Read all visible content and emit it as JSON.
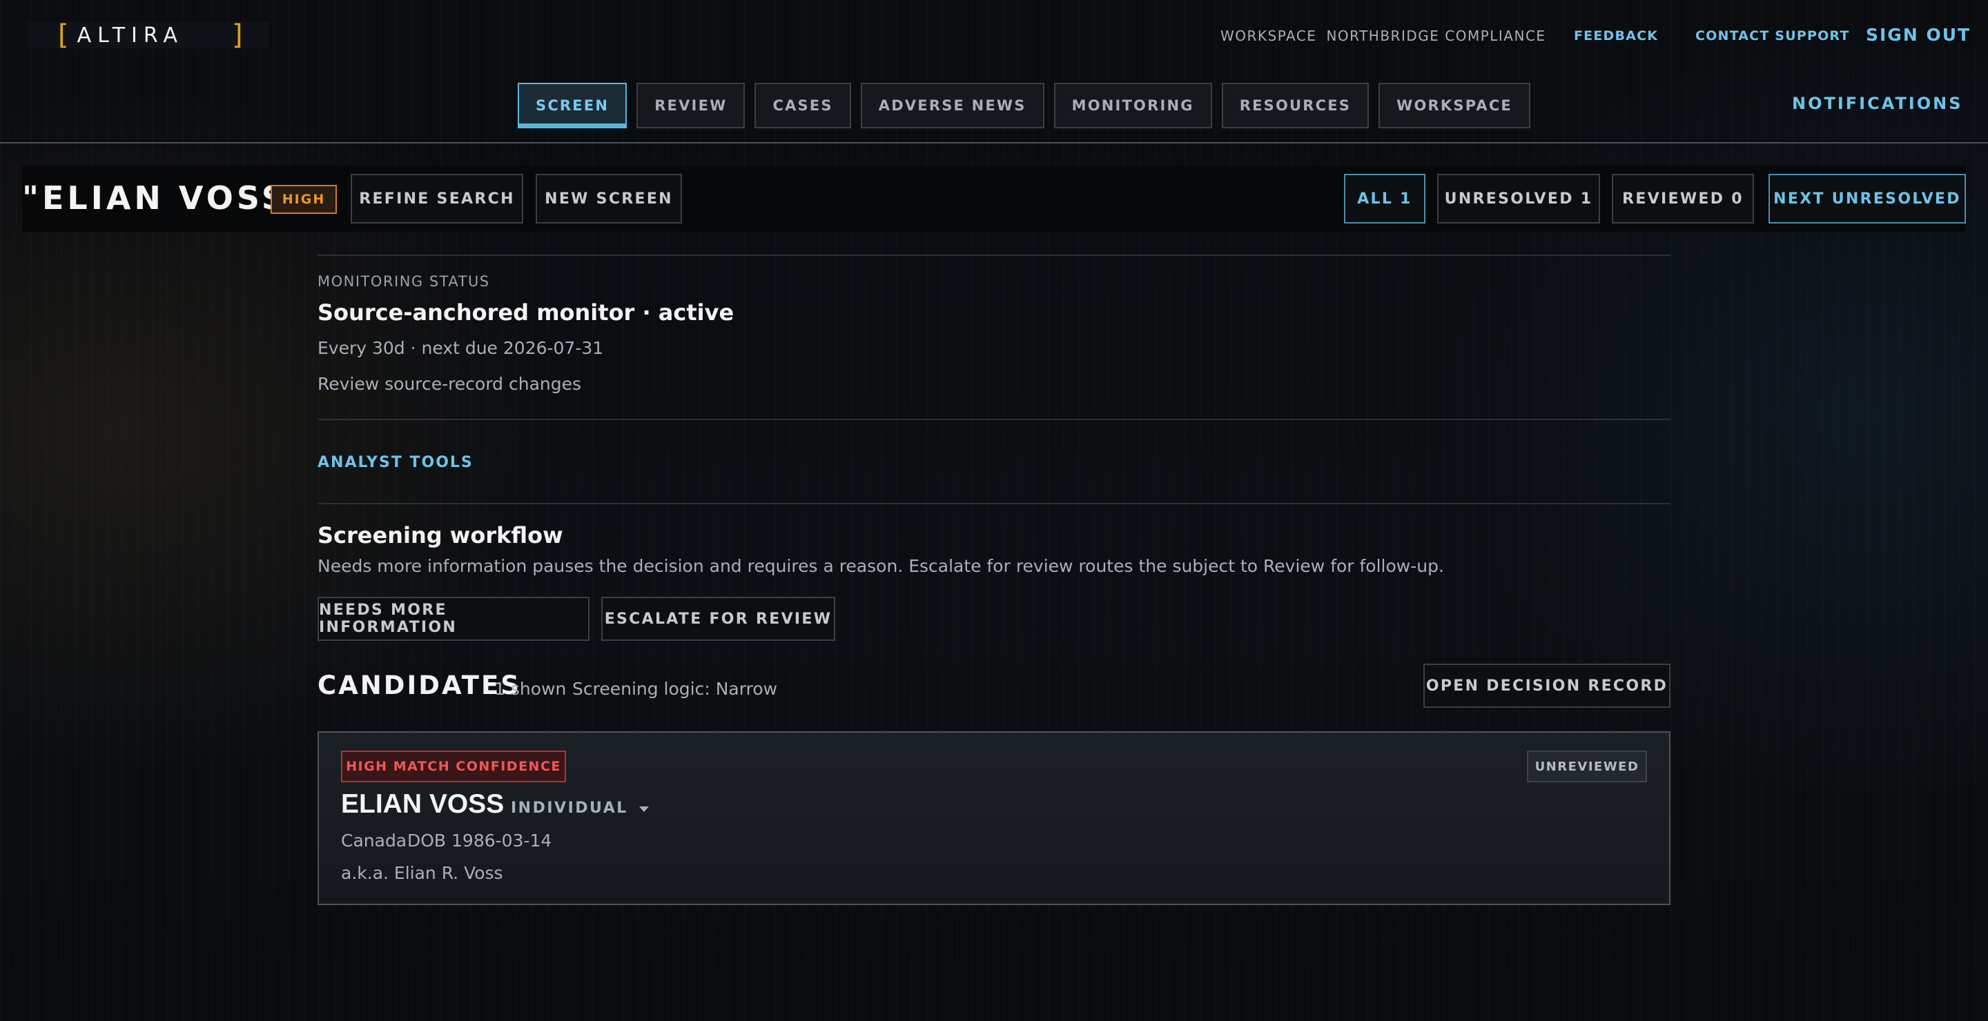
{
  "app": {
    "logo_text": "ALTIRA"
  },
  "header": {
    "workspace_label": "WORKSPACE",
    "workspace_name": "NORTHBRIDGE COMPLIANCE",
    "feedback": "FEEDBACK",
    "contact_support": "CONTACT SUPPORT",
    "sign_out": "SIGN OUT"
  },
  "nav": {
    "tabs": [
      {
        "label": "SCREEN",
        "active": true
      },
      {
        "label": "REVIEW"
      },
      {
        "label": "CASES"
      },
      {
        "label": "ADVERSE NEWS"
      },
      {
        "label": "MONITORING"
      },
      {
        "label": "RESOURCES"
      },
      {
        "label": "WORKSPACE"
      }
    ],
    "notifications": "NOTIFICATIONS"
  },
  "subject": {
    "query": "\"ELIAN VOSS\"",
    "risk_badge": "HIGH",
    "refine_search": "REFINE SEARCH",
    "new_screen": "NEW SCREEN",
    "filters": {
      "all": "ALL 1",
      "unresolved": "UNRESOLVED 1",
      "reviewed": "REVIEWED 0",
      "next_unresolved": "NEXT UNRESOLVED"
    }
  },
  "monitoring": {
    "label": "MONITORING STATUS",
    "title": "Source-anchored monitor · active",
    "schedule": "Every 30d · next due 2026-07-31",
    "note": "Review source-record changes"
  },
  "analyst_tools": "ANALYST TOOLS",
  "workflow": {
    "title": "Screening workflow",
    "description": "Needs more information pauses the decision and requires a reason. Escalate for review routes the subject to Review for follow-up.",
    "needs_more_info": "NEEDS MORE INFORMATION",
    "escalate": "ESCALATE FOR REVIEW"
  },
  "candidates": {
    "heading": "CANDIDATES",
    "shown": "1 shown",
    "logic": "Screening logic: Narrow",
    "open_decision_record": "OPEN DECISION RECORD",
    "items": [
      {
        "confidence": "HIGH MATCH CONFIDENCE",
        "status": "UNREVIEWED",
        "name": "ELIAN VOSS",
        "type": "INDIVIDUAL",
        "country": "Canada",
        "dob": "DOB 1986-03-14",
        "aka": "a.k.a. Elian R. Voss"
      }
    ]
  },
  "colors": {
    "accent": "#6ec3ea",
    "risk_high": "#f0962e",
    "confidence_high": "#ef5858",
    "background": "#0a0c10"
  }
}
